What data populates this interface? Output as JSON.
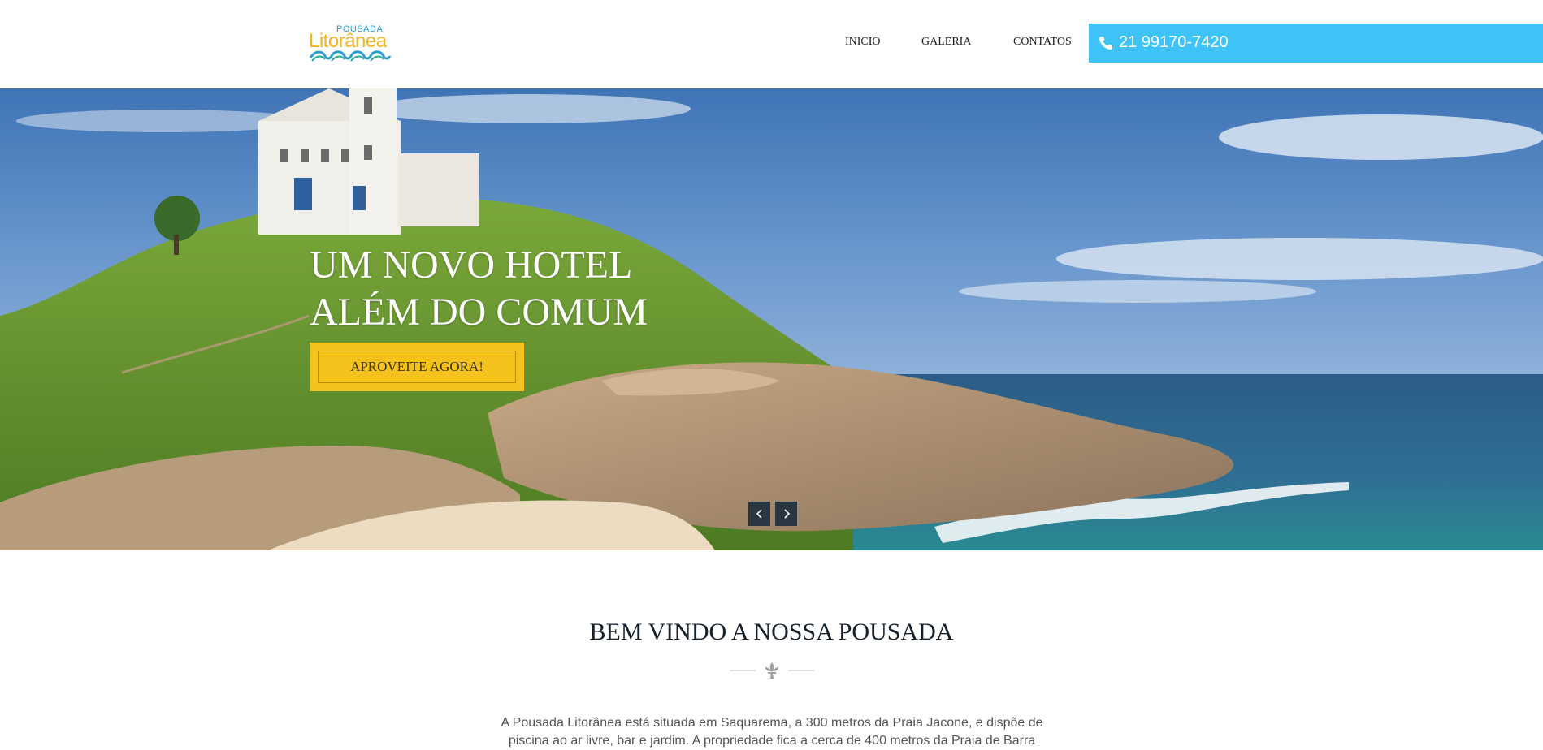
{
  "header": {
    "logo": {
      "top_text": "POUSADA",
      "main_text": "Litorânea"
    },
    "nav": [
      {
        "label": "INICIO"
      },
      {
        "label": "GALERIA"
      },
      {
        "label": "CONTATOS"
      }
    ],
    "phone": {
      "icon": "phone-icon",
      "number": "21 99170-7420"
    }
  },
  "hero": {
    "title_line1": "UM NOVO HOTEL",
    "title_line2": "ALÉM DO COMUM",
    "cta_label": "APROVEITE AGORA!",
    "prev_icon": "chevron-left-icon",
    "next_icon": "chevron-right-icon"
  },
  "welcome": {
    "title": "BEM VINDO A NOSSA POUSADA",
    "divider_icon": "fleur-de-lis-icon",
    "text": "A Pousada Litorânea está situada em Saquarema, a 300 metros da Praia Jacone, e dispõe de piscina ao ar livre, bar e jardim. A propriedade fica a cerca de 400 metros da Praia de Barra"
  },
  "colors": {
    "phone_bg": "#3ec3f7",
    "cta_bg": "#f4c21a",
    "logo_yellow": "#f1b521",
    "logo_blue": "#2b9bd0",
    "arrow_bg": "#2a3743"
  }
}
